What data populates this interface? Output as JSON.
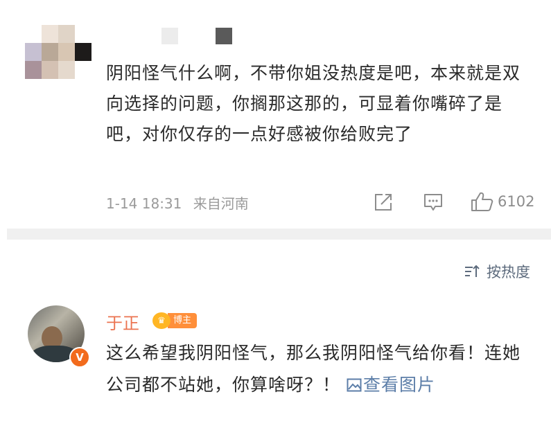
{
  "comment": {
    "text": "阴阳怪气什么啊，不带你姐没热度是吧，本来就是双向选择的问题，你搁那这那的，可显着你嘴碎了是吧，对你仅存的一点好感被你给败完了",
    "time": "1-14 18:31",
    "location": "来自河南",
    "like_count": "6102",
    "icons": [
      "share-icon",
      "comment-icon",
      "like-icon"
    ]
  },
  "sort": {
    "label": "按热度",
    "icon": "sort-icon"
  },
  "reply": {
    "author": "于正",
    "badge_label": "博主",
    "verified_mark": "V",
    "text": "这么希望我阴阳怪气，那么我阴阳怪气给你看！连她公司都不站她，你算啥呀？！",
    "view_image_label": "查看图片"
  },
  "colors": {
    "author_name": "#eb7350",
    "link": "#5c7ea8",
    "meta": "#9a9a9a",
    "badge_orange": "#ff8f3a",
    "verified": "#f26b1d"
  }
}
